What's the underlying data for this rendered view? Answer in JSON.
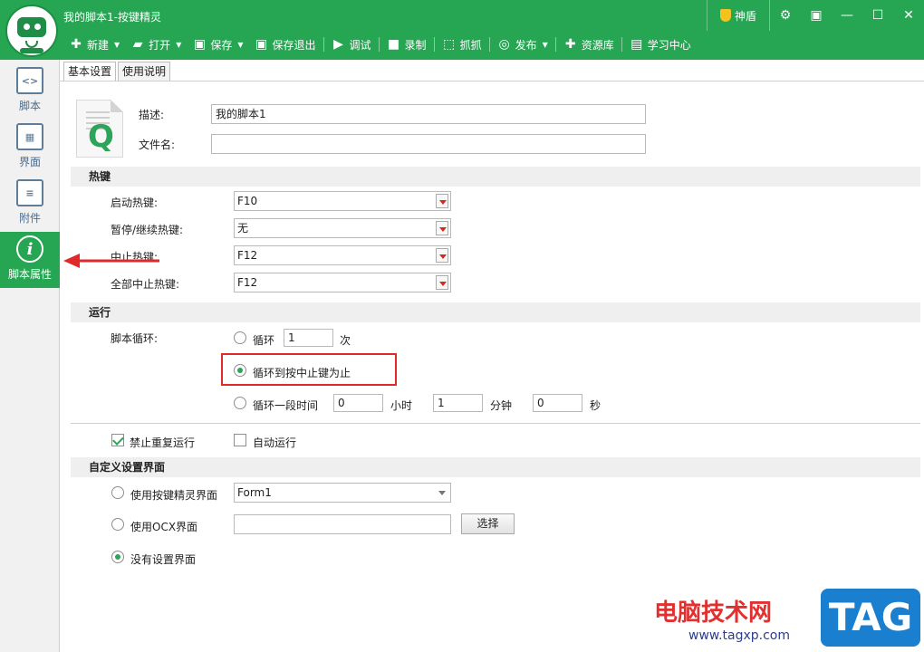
{
  "window": {
    "title": "我的脚本1-按键精灵",
    "shield_label": "神盾",
    "sys_icons": [
      "gear-icon",
      "menu-icon",
      "minimize-icon",
      "maximize-icon",
      "close-icon"
    ]
  },
  "toolbar": {
    "new": "新建",
    "open": "打开",
    "save": "保存",
    "save_exit": "保存退出",
    "debug": "调试",
    "record": "录制",
    "capture": "抓抓",
    "publish": "发布",
    "resources": "资源库",
    "learning": "学习中心"
  },
  "sidebar": {
    "items": [
      {
        "label": "脚本",
        "icon": "script-icon"
      },
      {
        "label": "界面",
        "icon": "layout-icon"
      },
      {
        "label": "附件",
        "icon": "attachment-icon"
      },
      {
        "label": "脚本属性",
        "icon": "info-icon"
      }
    ]
  },
  "tabs": [
    "基本设置",
    "使用说明"
  ],
  "basic": {
    "desc_label": "描述:",
    "desc_value": "我的脚本1",
    "filename_label": "文件名:",
    "filename_value": ""
  },
  "hotkeys": {
    "section": "热键",
    "start_label": "启动热键:",
    "start_value": "F10",
    "pause_label": "暂停/继续热键:",
    "pause_value": "无",
    "stop_label": "中止热键:",
    "stop_value": "F12",
    "stop_all_label": "全部中止热键:",
    "stop_all_value": "F12"
  },
  "run": {
    "section": "运行",
    "loop_label": "脚本循环:",
    "loop_opt": "循环",
    "loop_count": "1",
    "times_unit": "次",
    "until_stop": "循环到按中止键为止",
    "duration_opt": "循环一段时间",
    "hours": "0",
    "hours_unit": "小时",
    "minutes": "1",
    "minutes_unit": "分钟",
    "seconds": "0",
    "seconds_unit": "秒",
    "no_repeat": "禁止重复运行",
    "auto_run": "自动运行"
  },
  "custom_ui": {
    "section": "自定义设置界面",
    "use_builtin": "使用按键精灵界面",
    "form_value": "Form1",
    "use_ocx": "使用OCX界面",
    "ocx_value": "",
    "choose": "选择",
    "none": "没有设置界面"
  },
  "watermark": {
    "site": "电脑技术网",
    "url": "www.tagxp.com",
    "badge": "TAG"
  }
}
